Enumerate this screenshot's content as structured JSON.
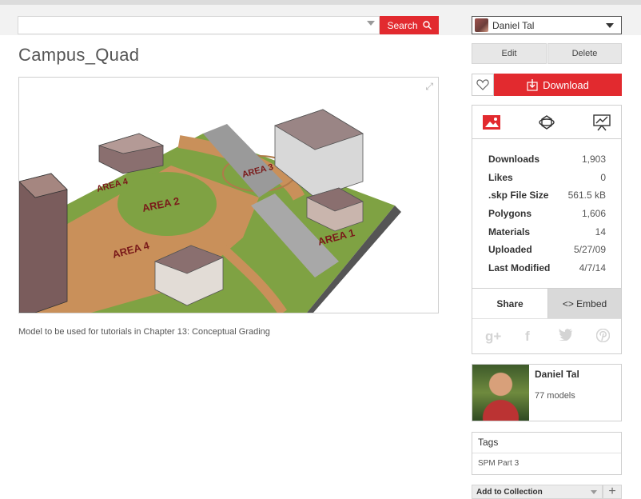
{
  "search": {
    "placeholder": "",
    "button_label": "Search"
  },
  "user_menu": {
    "name": "Daniel Tal"
  },
  "model": {
    "title": "Campus_Quad",
    "description": "Model to be used for tutorials in Chapter 13: Conceptual Grading",
    "viewer_labels": [
      "AREA 4",
      "AREA 2",
      "AREA 3",
      "AREA 4",
      "AREA 1"
    ]
  },
  "actions": {
    "edit_label": "Edit",
    "delete_label": "Delete",
    "download_label": "Download"
  },
  "stats": [
    {
      "key": "Downloads",
      "value": "1,903"
    },
    {
      "key": "Likes",
      "value": "0"
    },
    {
      "key": ".skp File Size",
      "value": "561.5 kB"
    },
    {
      "key": "Polygons",
      "value": "1,606"
    },
    {
      "key": "Materials",
      "value": "14"
    },
    {
      "key": "Uploaded",
      "value": "5/27/09"
    },
    {
      "key": "Last Modified",
      "value": "4/7/14"
    }
  ],
  "share_tabs": {
    "share_label": "Share",
    "embed_label": "<> Embed"
  },
  "social_icons": [
    "google-plus-icon",
    "facebook-icon",
    "twitter-icon",
    "pinterest-icon"
  ],
  "author": {
    "name": "Daniel Tal",
    "models_count": "77 models"
  },
  "tags": {
    "heading": "Tags",
    "items": [
      "SPM Part 3"
    ]
  },
  "collection": {
    "label": "Add to Collection"
  },
  "colors": {
    "accent": "#e22a2f",
    "panel_border": "#cfcfcf",
    "tab_inactive": "#d9d9d9"
  }
}
